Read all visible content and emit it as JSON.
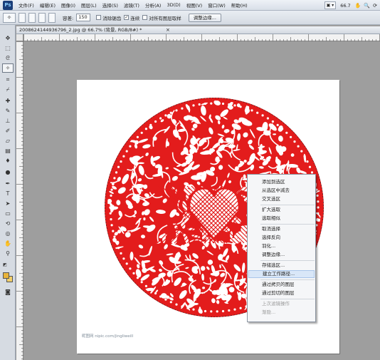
{
  "app": {
    "logo": "Ps"
  },
  "menu": [
    "文件(F)",
    "编辑(E)",
    "图像(I)",
    "图层(L)",
    "选择(S)",
    "滤镜(T)",
    "分析(A)",
    "3D(D)",
    "视图(V)",
    "窗口(W)",
    "帮助(H)"
  ],
  "menubar_right": {
    "zoom": "66.7",
    "icons": [
      "hand-icon",
      "zoom-icon",
      "rotate-icon"
    ]
  },
  "options": {
    "tolerance_label": "容差:",
    "tolerance_value": "150",
    "anti_alias": "消除锯齿",
    "anti_alias_checked": false,
    "contiguous": "连续",
    "contiguous_checked": true,
    "sample_all": "对所有图层取样",
    "sample_all_checked": false,
    "refine_edge": "调整边缘..."
  },
  "document": {
    "tab_title": "2008624144936796_2.jpg @ 66.7% (背景, RGB/8#) *",
    "close": "×",
    "watermark": "昵图网 nipic.com/jingliweill"
  },
  "artwork": {
    "fill_color": "#e31c1c"
  },
  "context_menu": {
    "items": [
      {
        "label": "添加到选区",
        "state": "normal"
      },
      {
        "label": "从选区中减去",
        "state": "normal"
      },
      {
        "label": "交叉选区",
        "state": "normal",
        "sep_after": true
      },
      {
        "label": "扩大选取",
        "state": "normal"
      },
      {
        "label": "选取相似",
        "state": "normal",
        "sep_after": true
      },
      {
        "label": "取消选择",
        "state": "normal"
      },
      {
        "label": "选择反向",
        "state": "normal"
      },
      {
        "label": "羽化...",
        "state": "normal"
      },
      {
        "label": "调整边缘...",
        "state": "normal",
        "sep_after": true
      },
      {
        "label": "存储选区...",
        "state": "normal"
      },
      {
        "label": "建立工作路径...",
        "state": "hover",
        "sep_after": true
      },
      {
        "label": "通过拷贝的图层",
        "state": "normal"
      },
      {
        "label": "通过剪切的图层",
        "state": "normal",
        "sep_after": true
      },
      {
        "label": "上次滤镜操作",
        "state": "disabled"
      },
      {
        "label": "渐隐...",
        "state": "disabled"
      }
    ]
  },
  "tools": [
    "move-tool-icon",
    "marquee-tool-icon",
    "lasso-tool-icon",
    "magic-wand-tool-icon",
    "crop-tool-icon",
    "eyedropper-tool-icon",
    "healing-brush-tool-icon",
    "brush-tool-icon",
    "clone-stamp-tool-icon",
    "history-brush-tool-icon",
    "eraser-tool-icon",
    "gradient-tool-icon",
    "blur-tool-icon",
    "dodge-tool-icon",
    "pen-tool-icon",
    "type-tool-icon",
    "path-selection-tool-icon",
    "shape-tool-icon",
    "3d-rotate-tool-icon",
    "3d-orbit-tool-icon",
    "hand-tool-icon",
    "zoom-tool-icon"
  ],
  "colors": {
    "foreground": "#e8b33a",
    "background": "#f1cf6a",
    "menu_hover": "#d9e7f8"
  }
}
